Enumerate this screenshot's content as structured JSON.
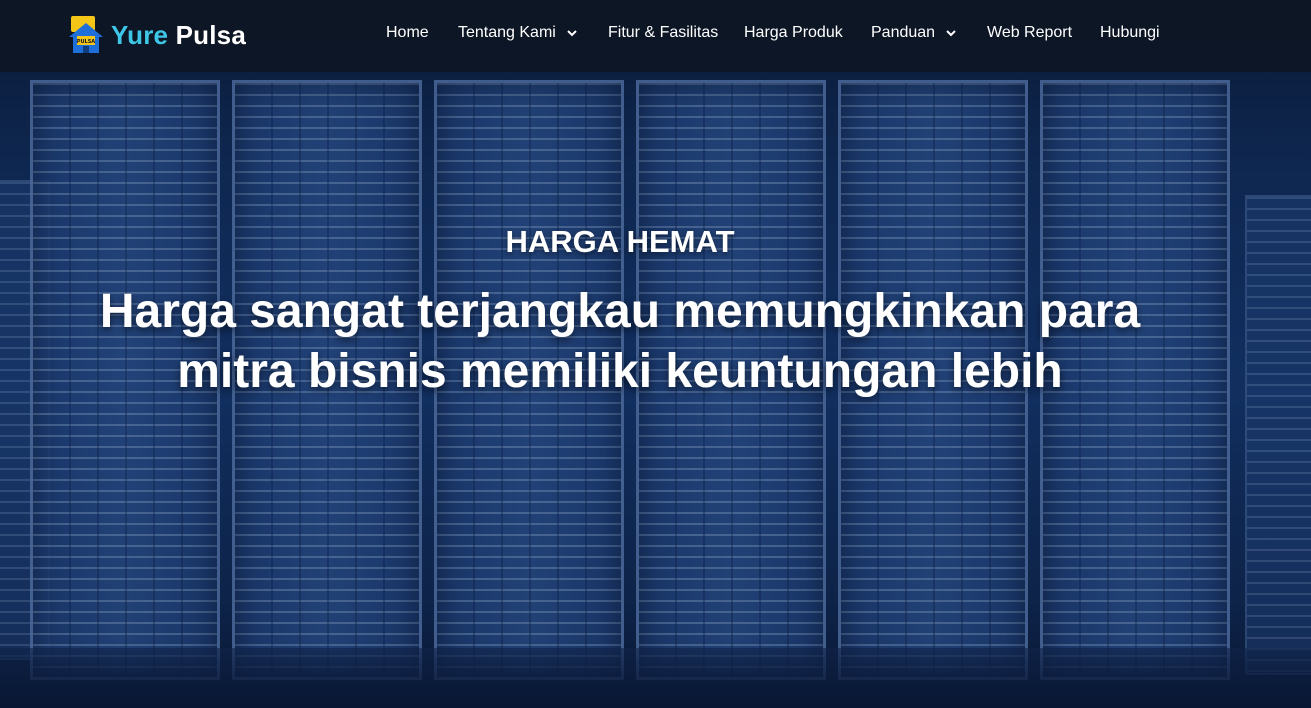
{
  "brand": {
    "name_part1": "Yure",
    "name_part2": "Pulsa",
    "logo_text": "PULSA"
  },
  "nav": {
    "items": [
      {
        "label": "Home",
        "has_dropdown": false
      },
      {
        "label": "Tentang Kami",
        "has_dropdown": true
      },
      {
        "label": "Fitur & Fasilitas",
        "has_dropdown": false
      },
      {
        "label": "Harga Produk",
        "has_dropdown": false
      },
      {
        "label": "Panduan",
        "has_dropdown": true
      },
      {
        "label": "Web Report",
        "has_dropdown": false
      },
      {
        "label": "Hubungi",
        "has_dropdown": false
      }
    ]
  },
  "hero": {
    "eyebrow": "HARGA HEMAT",
    "headline_line1": "Harga sangat terjangkau memungkinkan para",
    "headline_line2": "mitra bisnis memiliki keuntungan lebih"
  },
  "colors": {
    "accent": "#3ec6e6",
    "navbar_bg": "#0e1624",
    "text": "#ffffff",
    "logo_yellow": "#f5c518",
    "logo_blue": "#1e6fd9"
  }
}
